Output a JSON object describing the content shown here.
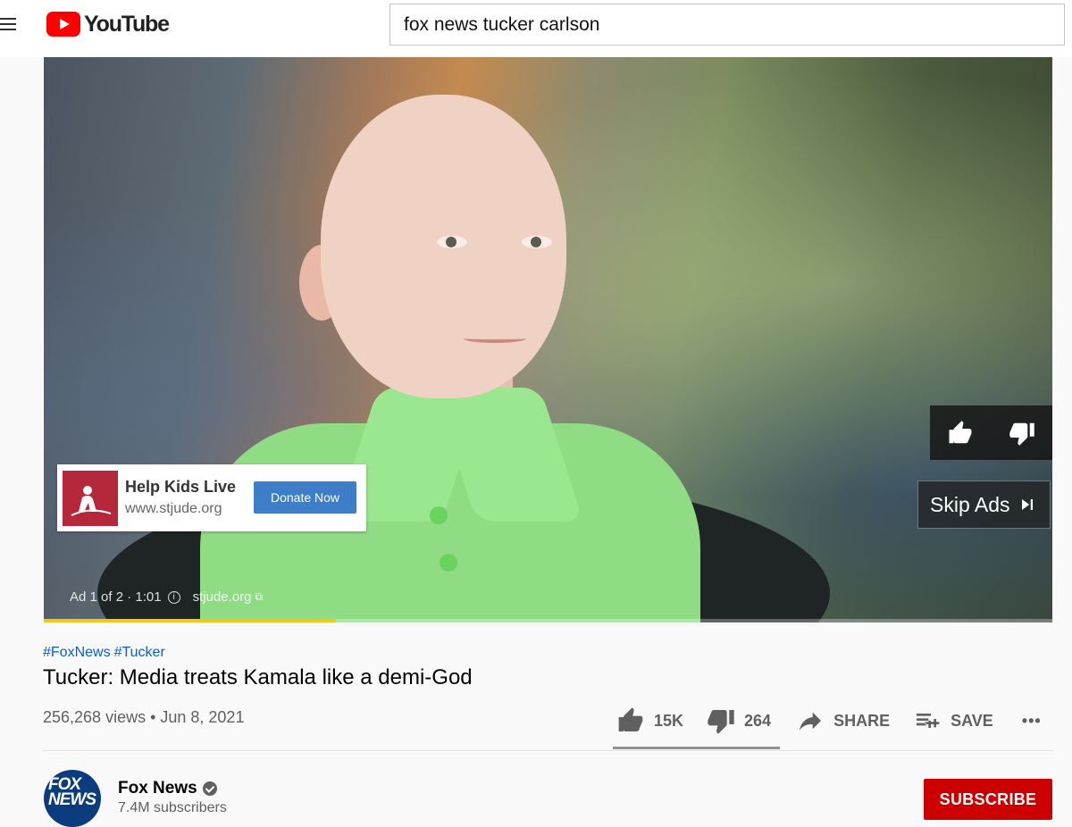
{
  "header": {
    "brand": "YouTube",
    "search_value": "fox news tucker carlson"
  },
  "player": {
    "ad_card": {
      "title": "Help Kids Live",
      "url": "www.stjude.org",
      "cta": "Donate Now"
    },
    "skip_label": "Skip Ads",
    "ad_info": "Ad 1 of 2 · 1:01",
    "ad_info_icon": "i",
    "ad_site": "stjude.org",
    "ad_site_icon": "⧉",
    "ad_progress_fraction": 0.29,
    "colors": {
      "progress": "#f5c518",
      "accent_blue": "#3e7ec9"
    }
  },
  "video": {
    "hashtags": [
      "#FoxNews",
      "#Tucker"
    ],
    "title": "Tucker: Media treats Kamala like a demi-God",
    "meta": "256,268 views • Jun 8, 2021",
    "actions": {
      "likes": "15K",
      "dislikes": "264",
      "share": "SHARE",
      "save": "SAVE",
      "more": "•••"
    }
  },
  "channel": {
    "avatar_text_1": "FOX",
    "avatar_text_2": "NEWS",
    "name": "Fox News",
    "subscribers": "7.4M subscribers",
    "subscribe_label": "SUBSCRIBE",
    "subscribe_color": "#cc0000"
  }
}
